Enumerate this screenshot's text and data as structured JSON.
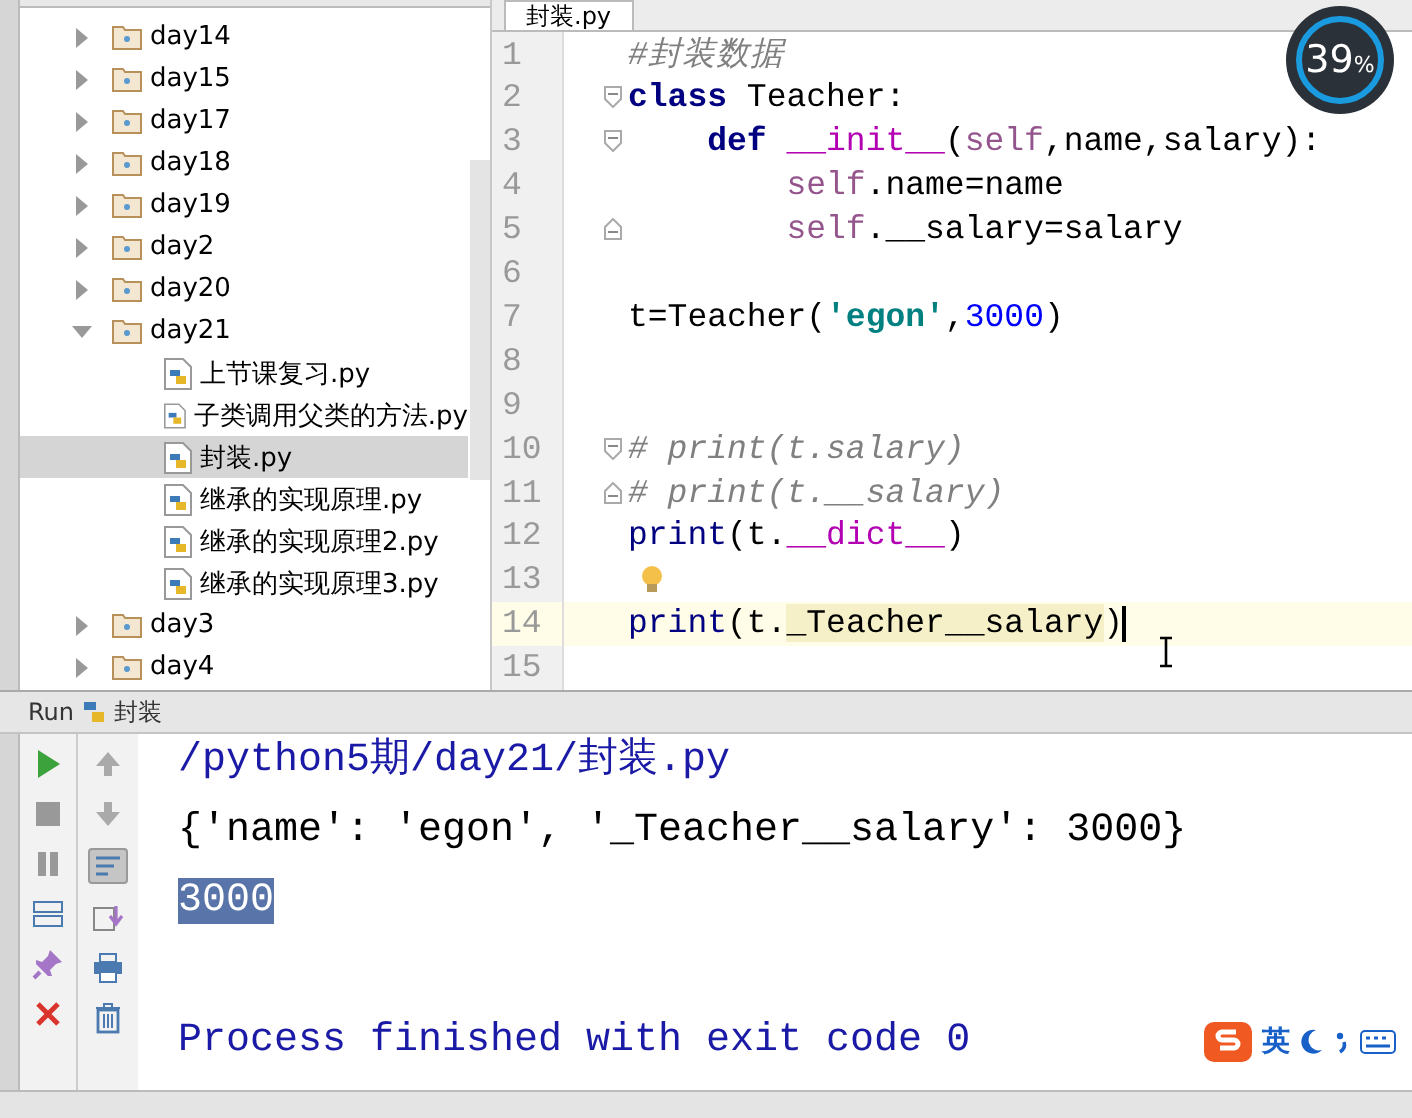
{
  "editor_tab": {
    "label": "封装.py"
  },
  "project_tree": [
    {
      "label": "day14",
      "kind": "folder",
      "expanded": false,
      "selected": false
    },
    {
      "label": "day15",
      "kind": "folder",
      "expanded": false,
      "selected": false
    },
    {
      "label": "day17",
      "kind": "folder",
      "expanded": false,
      "selected": false
    },
    {
      "label": "day18",
      "kind": "folder",
      "expanded": false,
      "selected": false
    },
    {
      "label": "day19",
      "kind": "folder",
      "expanded": false,
      "selected": false
    },
    {
      "label": "day2",
      "kind": "folder",
      "expanded": false,
      "selected": false
    },
    {
      "label": "day20",
      "kind": "folder",
      "expanded": false,
      "selected": false
    },
    {
      "label": "day21",
      "kind": "folder",
      "expanded": true,
      "selected": false,
      "children": [
        {
          "label": "上节课复习.py",
          "kind": "file",
          "selected": false
        },
        {
          "label": "子类调用父类的方法.py",
          "kind": "file",
          "selected": false
        },
        {
          "label": "封装.py",
          "kind": "file",
          "selected": true
        },
        {
          "label": "继承的实现原理.py",
          "kind": "file",
          "selected": false
        },
        {
          "label": "继承的实现原理2.py",
          "kind": "file",
          "selected": false
        },
        {
          "label": "继承的实现原理3.py",
          "kind": "file",
          "selected": false
        }
      ]
    },
    {
      "label": "day3",
      "kind": "folder",
      "expanded": false,
      "selected": false
    },
    {
      "label": "day4",
      "kind": "folder",
      "expanded": false,
      "selected": false
    }
  ],
  "code_lines": [
    {
      "number": "1",
      "current": false,
      "tokens": [
        {
          "text": "#封装数据",
          "kind": "comment"
        }
      ]
    },
    {
      "number": "2",
      "current": false,
      "fold_start": true,
      "tokens": [
        {
          "text": "class",
          "kind": "keyword"
        },
        {
          "text": " Teacher:",
          "kind": "plain"
        }
      ]
    },
    {
      "number": "3",
      "current": false,
      "fold_start": true,
      "tokens": [
        {
          "text": "    def ",
          "kind": "keyword"
        },
        {
          "text": "__init__",
          "kind": "magic"
        },
        {
          "text": "(",
          "kind": "plain"
        },
        {
          "text": "self",
          "kind": "self"
        },
        {
          "text": ",name,salary):",
          "kind": "plain"
        }
      ]
    },
    {
      "number": "4",
      "current": false,
      "tokens": [
        {
          "text": "        self",
          "kind": "self"
        },
        {
          "text": ".name=name",
          "kind": "plain"
        }
      ]
    },
    {
      "number": "5",
      "current": false,
      "fold_end": true,
      "tokens": [
        {
          "text": "        self",
          "kind": "self"
        },
        {
          "text": ".__salary=salary",
          "kind": "plain"
        }
      ]
    },
    {
      "number": "6",
      "current": false
    },
    {
      "number": "7",
      "current": false,
      "tokens": [
        {
          "text": "t=Teacher(",
          "kind": "plain"
        },
        {
          "text": "'egon'",
          "kind": "string"
        },
        {
          "text": ",",
          "kind": "plain"
        },
        {
          "text": "3000",
          "kind": "number"
        },
        {
          "text": ")",
          "kind": "plain"
        }
      ]
    },
    {
      "number": "8",
      "current": false
    },
    {
      "number": "9",
      "current": false
    },
    {
      "number": "10",
      "current": false,
      "fold_start": true,
      "tokens": [
        {
          "text": "# print(t.salary)",
          "kind": "comment"
        }
      ]
    },
    {
      "number": "11",
      "current": false,
      "fold_end": true,
      "tokens": [
        {
          "text": "# print(t.__salary)",
          "kind": "comment"
        }
      ]
    },
    {
      "number": "12",
      "current": false,
      "tokens": [
        {
          "text": "print",
          "kind": "builtin"
        },
        {
          "text": "(t.",
          "kind": "plain"
        },
        {
          "text": "__dict__",
          "kind": "magic"
        },
        {
          "text": ")",
          "kind": "plain"
        }
      ]
    },
    {
      "number": "13",
      "current": false,
      "hint": true
    },
    {
      "number": "14",
      "current": true,
      "tokens": [
        {
          "text": "print",
          "kind": "builtin"
        },
        {
          "text": "(t.",
          "kind": "plain"
        },
        {
          "text": "_Teacher__salary",
          "kind": "highlight"
        },
        {
          "text": ")",
          "kind": "plain"
        }
      ]
    },
    {
      "number": "15",
      "current": false
    }
  ],
  "progress_badge": {
    "value": "39",
    "unit": "%"
  },
  "run_panel": {
    "label": "Run",
    "config": "封装",
    "output": [
      {
        "text": "/python5期/day21/封装.py",
        "kind": "path"
      },
      {
        "text": "{'name': 'egon', '_Teacher__salary': 3000}",
        "kind": "plain"
      },
      {
        "text": "3000",
        "kind": "selected"
      },
      {
        "kind": "blank"
      },
      {
        "text": "Process finished with exit code 0",
        "kind": "system"
      }
    ]
  },
  "ime_toolbar": {
    "mode": "英"
  }
}
